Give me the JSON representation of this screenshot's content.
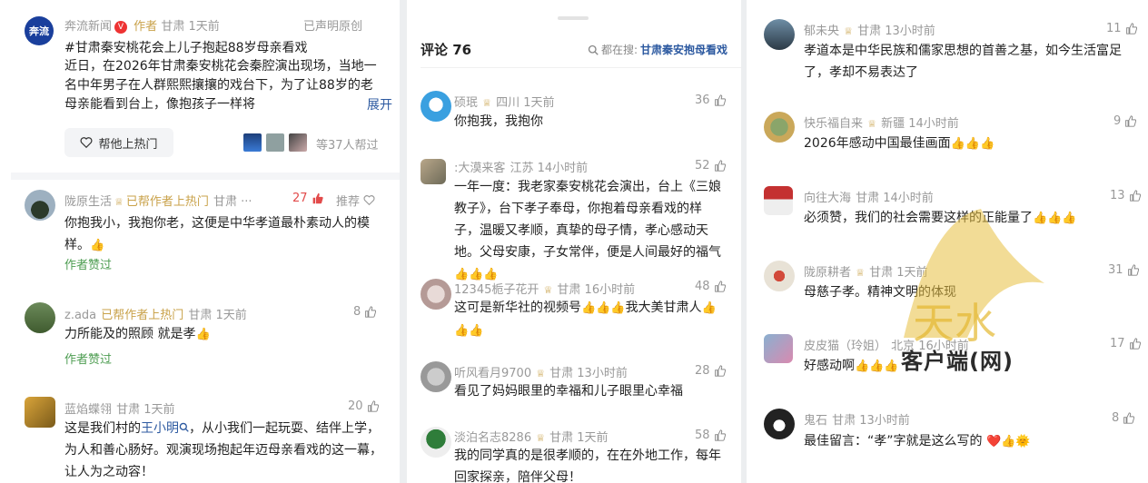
{
  "panel1": {
    "source": "奔流新闻",
    "logo_text": "奔流",
    "author_tag": "作者",
    "location_time": "甘肃 1天前",
    "declared": "已声明原创",
    "hashtag": "#甘肃秦安桃花会上儿子抱起88岁母亲看戏",
    "body": "近日，在2026年甘肃秦安桃花会秦腔演出现场，当地一名中年男子在人群熙熙攘攘的戏台下，为了让88岁的老母亲能看到台上，像抱孩子一样将",
    "body_more": "展开",
    "hot_button": "帮他上热门",
    "helpers": "等37人帮过",
    "comments": [
      {
        "user": "陇原生活",
        "badge": "已帮作者上热门",
        "loc": "甘肃 ···",
        "likes": "27",
        "recommend": "推荐",
        "text": "你抱我小，我抱你老，这便是中华孝道最朴素动人的模样。",
        "emoji": "👍",
        "author_liked": "作者赞过"
      },
      {
        "user": "z.ada",
        "badge": "已帮作者上热门",
        "loc": "甘肃 1天前",
        "likes": "8",
        "text": "力所能及的照顾 就是孝",
        "emoji": "👍",
        "author_liked": "作者赞过"
      },
      {
        "user": "蓝焰蝶翎",
        "loc": "甘肃 1天前",
        "likes": "20",
        "text_a": "这是我们村的",
        "text_link": "王小明",
        "text_b": "，从小我们一起玩耍、结伴上学，为人和善心肠好。观演现场抱起年迈母亲看戏的这一幕，让人为之动容！"
      }
    ]
  },
  "panel2": {
    "title": "评论 76",
    "search_prefix": "都在搜:",
    "search_term": "甘肃秦安抱母看戏",
    "comments": [
      {
        "user": "硕珉",
        "loc": "四川 1天前",
        "likes": "36",
        "text": "你抱我，我抱你"
      },
      {
        "user": ":大漠来客",
        "loc": "江苏 14小时前",
        "likes": "52",
        "text": "一年一度：我老家秦安桃花会演出，台上《三娘教子》，台下孝子奉母，你抱着母亲看戏的样子，温暖又孝顺，真挚的母子情，孝心感动天地。父母安康，子女常伴，便是人间最好的福气",
        "emoji": "👍👍👍"
      },
      {
        "user": "12345栀子花开",
        "loc": "甘肃 16小时前",
        "likes": "48",
        "text": "这可是新华社的视频号",
        "emoji_a": "👍👍👍",
        "text_b": "我大美甘肃人",
        "emoji_b": "👍👍👍"
      },
      {
        "user": "听风看月9700",
        "loc": "甘肃 13小时前",
        "likes": "28",
        "text": "看见了妈妈眼里的幸福和儿子眼里心幸福"
      },
      {
        "user": "淡泊名志8286",
        "loc": "甘肃 1天前",
        "likes": "58",
        "text": "我的同学真的是很孝顺的，在在外地工作，每年回家探亲，陪伴父母！"
      }
    ]
  },
  "panel3": {
    "comments": [
      {
        "user": "郁未央",
        "loc": "甘肃 13小时前",
        "likes": "11",
        "text": "孝道本是中华民族和儒家思想的首善之基，如今生活富足了，孝却不易表达了"
      },
      {
        "user": "快乐福自来",
        "loc": "新疆 14小时前",
        "likes": "9",
        "text": "2026年感动中国最佳画面",
        "emoji": "👍👍👍"
      },
      {
        "user": "向往大海",
        "loc": "甘肃 14小时前",
        "likes": "13",
        "text": "必须赞，我们的社会需要这样的正能量了",
        "emoji": "👍👍👍"
      },
      {
        "user": "陇原耕者",
        "loc": "甘肃 1天前",
        "likes": "31",
        "text": "母慈子孝。精神文明的体现"
      },
      {
        "user": "皮皮猫（玲姐）",
        "loc": "北京 16小时前",
        "likes": "17",
        "text": "好感动啊",
        "emoji": "👍👍👍"
      },
      {
        "user": "鬼石",
        "loc": "甘肃 13小时前",
        "likes": "8",
        "text": "最佳留言：“孝”字就是这么写的",
        "emoji": "❤️👍🌞"
      }
    ]
  },
  "watermark": {
    "logo_text": "天水",
    "caption": "客户端(网)"
  },
  "colors": {
    "accent_green": "#4e9d52",
    "badge_gold": "#c9a24a",
    "link_blue": "#2c59a0",
    "like_red": "#e24b4b"
  }
}
